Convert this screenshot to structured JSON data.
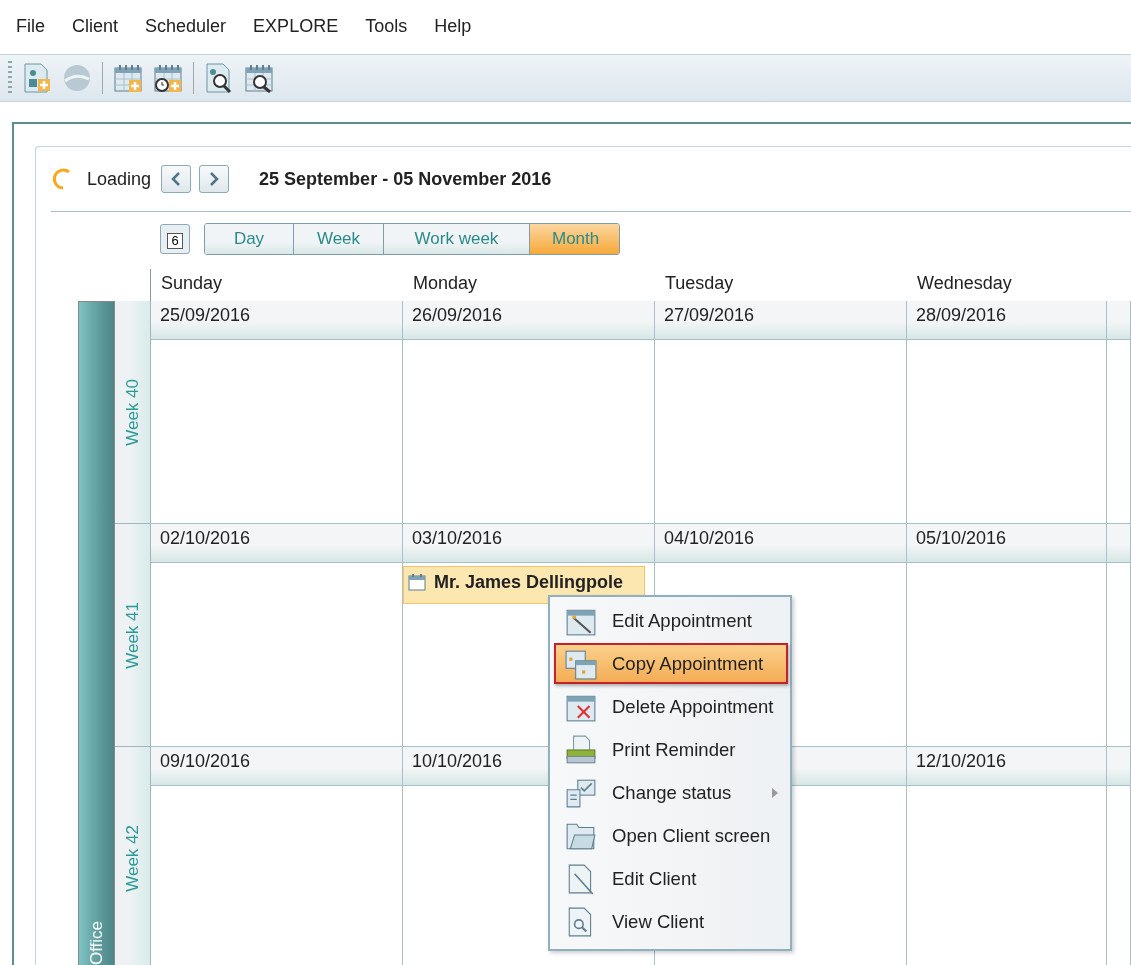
{
  "menu_bar": [
    {
      "label": "File"
    },
    {
      "label": "Client"
    },
    {
      "label": "Scheduler"
    },
    {
      "label": "EXPLORE"
    },
    {
      "label": "Tools"
    },
    {
      "label": "Help"
    }
  ],
  "scheduler": {
    "status": "Loading",
    "date_range": "25 September - 05 November 2016",
    "today_day": "6",
    "views": [
      {
        "label": "Day",
        "selected": false
      },
      {
        "label": "Week",
        "selected": false
      },
      {
        "label": "Work week",
        "selected": false
      },
      {
        "label": "Month",
        "selected": true
      }
    ],
    "days": [
      "Sunday",
      "Monday",
      "Tuesday",
      "Wednesday"
    ],
    "resource": "Office",
    "weeks": [
      {
        "label": "Week 40",
        "cells": [
          {
            "date": "25/09/2016"
          },
          {
            "date": "26/09/2016"
          },
          {
            "date": "27/09/2016"
          },
          {
            "date": "28/09/2016"
          }
        ]
      },
      {
        "label": "Week 41",
        "cells": [
          {
            "date": "02/10/2016"
          },
          {
            "date": "03/10/2016",
            "appointments": [
              {
                "title": "Mr. James Dellingpole",
                "selected": true
              }
            ]
          },
          {
            "date": "04/10/2016"
          },
          {
            "date": "05/10/2016"
          }
        ]
      },
      {
        "label": "Week 42",
        "cells": [
          {
            "date": "09/10/2016"
          },
          {
            "date": "10/10/2016"
          },
          {},
          {
            "date": "12/10/2016"
          }
        ]
      }
    ]
  },
  "context_menu": {
    "items": [
      {
        "label": "Edit Appointment",
        "selected": false,
        "has_submenu": false
      },
      {
        "label": "Copy Appointment",
        "selected": true,
        "has_submenu": false
      },
      {
        "label": "Delete Appointment",
        "selected": false,
        "has_submenu": false
      },
      {
        "label": "Print Reminder",
        "selected": false,
        "has_submenu": false
      },
      {
        "label": "Change status",
        "selected": false,
        "has_submenu": true
      },
      {
        "label": "Open Client screen",
        "selected": false,
        "has_submenu": false
      },
      {
        "label": "Edit Client",
        "selected": false,
        "has_submenu": false
      },
      {
        "label": "View Client",
        "selected": false,
        "has_submenu": false
      }
    ]
  }
}
